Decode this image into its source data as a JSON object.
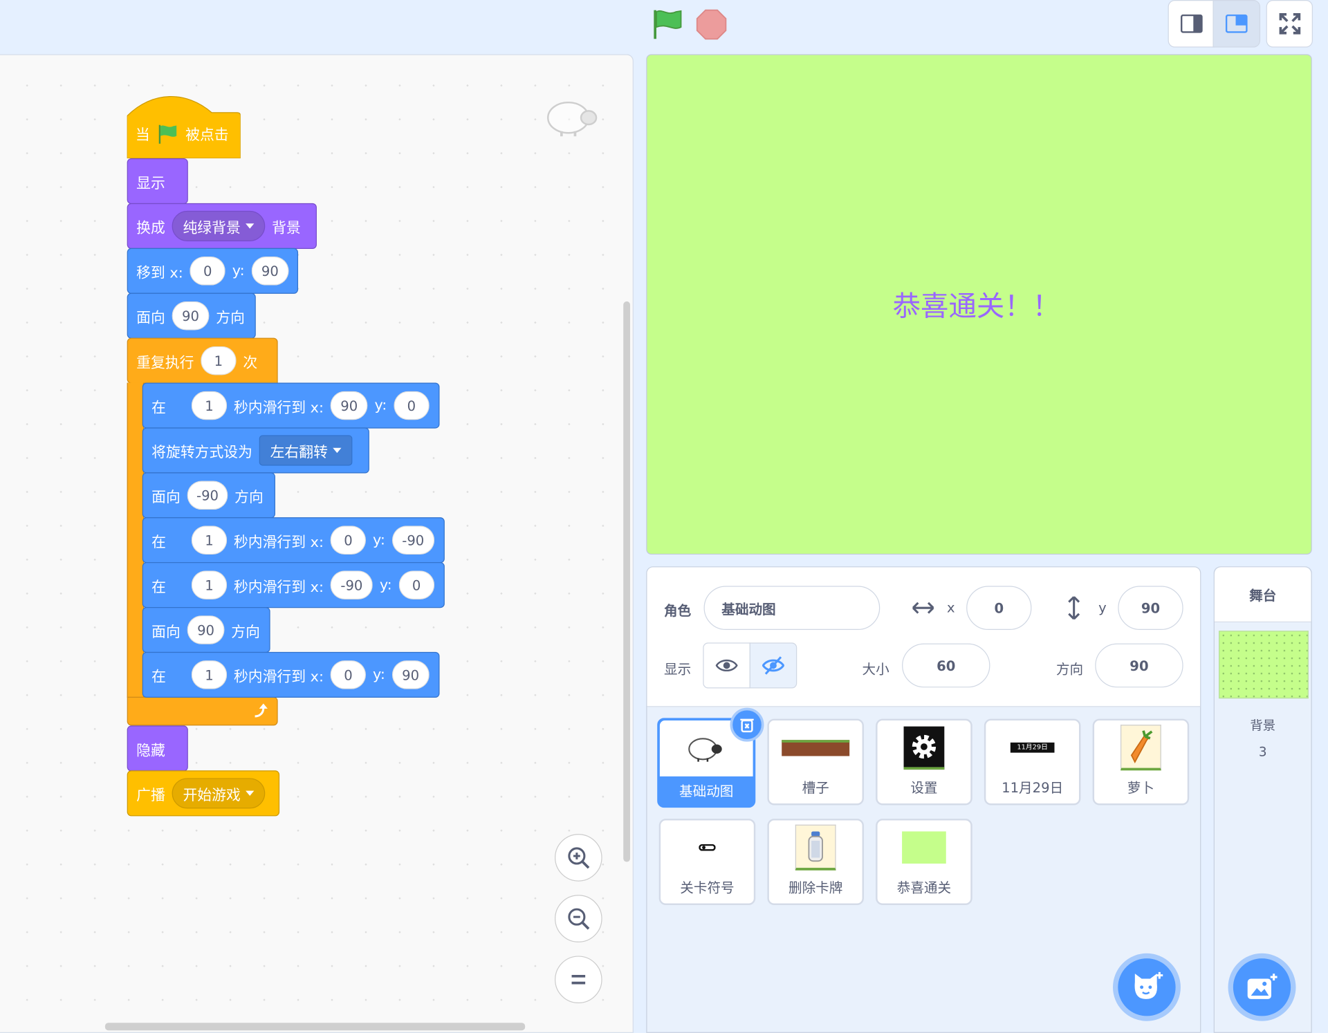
{
  "topbar": {
    "flag_icon": "green-flag-icon",
    "stop_icon": "stop-icon",
    "small_stage_icon": "small-stage-mode-icon",
    "normal_stage_icon": "normal-stage-mode-icon",
    "fullscreen_icon": "fullscreen-icon"
  },
  "script": {
    "when_prefix": "当",
    "when_suffix": "被点击",
    "show": "显示",
    "switch_prefix": "换成",
    "switch_value": "纯绿背景",
    "switch_suffix": "背景",
    "goto_label": "移到 x:",
    "goto_x": "0",
    "y_label": "y:",
    "goto_y": "90",
    "face_prefix": "面向",
    "face1": "90",
    "face_suffix": "方向",
    "repeat_label": "重复执行",
    "repeat_count": "1",
    "repeat_suffix": "次",
    "glide_prefix": "在",
    "glide_mid": "秒内滑行到 x:",
    "glide1": {
      "secs": "1",
      "x": "90",
      "y": "0"
    },
    "rotation_label": "将旋转方式设为",
    "rotation_value": "左右翻转",
    "face2": "-90",
    "glide2": {
      "secs": "1",
      "x": "0",
      "y": "-90"
    },
    "glide3": {
      "secs": "1",
      "x": "-90",
      "y": "0"
    },
    "face3": "90",
    "glide4": {
      "secs": "1",
      "x": "0",
      "y": "90"
    },
    "hide": "隐藏",
    "broadcast_label": "广播",
    "broadcast_value": "开始游戏"
  },
  "stage": {
    "text": "恭喜通关！！",
    "bg_color": "#c5fe8b"
  },
  "sprite_info": {
    "sprite_label": "角色",
    "sprite_name": "基础动图",
    "x_label": "x",
    "x_value": "0",
    "y_label": "y",
    "y_value": "90",
    "show_label": "显示",
    "size_label": "大小",
    "size_value": "60",
    "direction_label": "方向",
    "direction_value": "90"
  },
  "sprites": [
    {
      "name": "基础动图",
      "icon": "sheep-icon",
      "selected": true
    },
    {
      "name": "槽子",
      "icon": "slot-icon"
    },
    {
      "name": "设置",
      "icon": "gear-icon"
    },
    {
      "name": "11月29日",
      "icon": "date-bar-icon",
      "thumb_text": "11月29日"
    },
    {
      "name": "萝卜",
      "icon": "carrot-icon"
    },
    {
      "name": "关卡符号",
      "icon": "level-symbol-icon"
    },
    {
      "name": "删除卡牌",
      "icon": "bottle-icon"
    },
    {
      "name": "恭喜通关",
      "icon": "green-card-icon"
    }
  ],
  "stage_panel": {
    "title": "舞台",
    "backdrop_label": "背景",
    "backdrop_count": "3"
  }
}
